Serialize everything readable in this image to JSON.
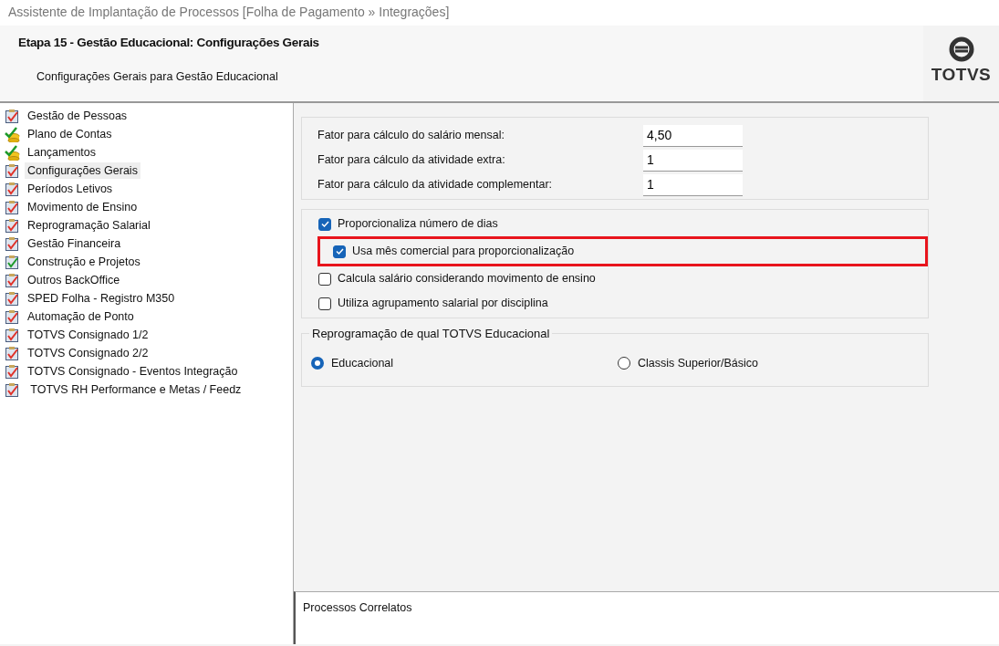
{
  "window": {
    "title": "Assistente de Implantação de Processos [Folha de Pagamento » Integrações]"
  },
  "header": {
    "title": "Etapa 15 - Gestão Educacional: Configurações Gerais",
    "subtitle": "Configurações Gerais para Gestão Educacional",
    "logo_text": "TOTVS"
  },
  "sidebar": {
    "items": [
      {
        "label": "Gestão de Pessoas",
        "kind": "pending",
        "selected": false
      },
      {
        "label": "Plano de Contas",
        "kind": "database",
        "selected": false
      },
      {
        "label": "Lançamentos",
        "kind": "database",
        "selected": false
      },
      {
        "label": "Configurações Gerais",
        "kind": "pending",
        "selected": true
      },
      {
        "label": "Períodos Letivos",
        "kind": "pending",
        "selected": false
      },
      {
        "label": "Movimento de Ensino",
        "kind": "pending",
        "selected": false
      },
      {
        "label": "Reprogramação Salarial",
        "kind": "pending",
        "selected": false
      },
      {
        "label": "Gestão Financeira",
        "kind": "pending",
        "selected": false
      },
      {
        "label": "Construção e Projetos",
        "kind": "done",
        "selected": false
      },
      {
        "label": "Outros BackOffice",
        "kind": "pending",
        "selected": false
      },
      {
        "label": "SPED Folha - Registro M350",
        "kind": "pending",
        "selected": false
      },
      {
        "label": "Automação de Ponto",
        "kind": "pending",
        "selected": false
      },
      {
        "label": "TOTVS Consignado 1/2",
        "kind": "pending",
        "selected": false
      },
      {
        "label": "TOTVS Consignado 2/2",
        "kind": "pending",
        "selected": false
      },
      {
        "label": "TOTVS Consignado - Eventos Integração",
        "kind": "pending",
        "selected": false
      },
      {
        "label": " TOTVS RH Performance e Metas / Feedz",
        "kind": "pending",
        "selected": false
      }
    ]
  },
  "factors": [
    {
      "label": "Fator para cálculo do salário mensal:",
      "value": "4,50"
    },
    {
      "label": "Fator para cálculo da atividade extra:",
      "value": "1"
    },
    {
      "label": "Fator para cálculo da atividade complementar:",
      "value": "1"
    }
  ],
  "options": [
    {
      "label": "Proporcionaliza número de dias",
      "checked": true,
      "indented": false,
      "highlighted": false
    },
    {
      "label": "Usa mês comercial para proporcionalização",
      "checked": true,
      "indented": true,
      "highlighted": true
    },
    {
      "label": "Calcula salário considerando movimento de ensino",
      "checked": false,
      "indented": false,
      "highlighted": false
    },
    {
      "label": "Utiliza agrupamento salarial por disciplina",
      "checked": false,
      "indented": false,
      "highlighted": false
    }
  ],
  "reprogramming": {
    "legend": "Reprogramação de qual TOTVS Educacional",
    "choices": [
      {
        "label": "Educacional",
        "selected": true
      },
      {
        "label": "Classis Superior/Básico",
        "selected": false
      }
    ]
  },
  "related": {
    "title": "Processos Correlatos"
  }
}
